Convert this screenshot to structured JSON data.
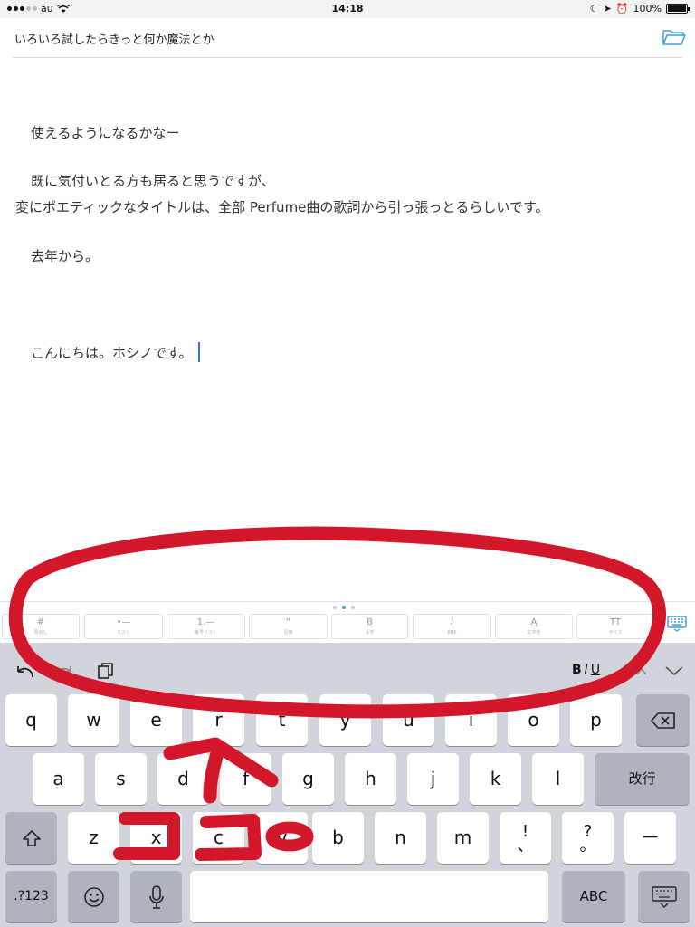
{
  "status": {
    "carrier": "au",
    "time": "14:18",
    "battery": "100%"
  },
  "header": {
    "title": "いろいろ試したらきっと何か魔法とか",
    "folder_icon": "folder-icon"
  },
  "editor": {
    "lines": [
      "使えるようになるかなー",
      "既に気付いとる方も居ると思うですが、",
      "変にポエティックなタイトルは、全部 Perfume曲の歌詞から引っ張っとるらしいです。",
      "去年から。",
      "こんにちは。ホシノです。"
    ],
    "caret_color": "#3b6fe0"
  },
  "toolbar": {
    "page_count": 3,
    "active_page": 1,
    "buttons": [
      {
        "symbol": "#",
        "label": "見出し"
      },
      {
        "symbol": "•—",
        "label": "リスト"
      },
      {
        "symbol": "1.—",
        "label": "番号リスト"
      },
      {
        "symbol": "“",
        "label": "引用"
      },
      {
        "symbol": "B",
        "label": "太字"
      },
      {
        "symbol": "i",
        "label": "斜体"
      },
      {
        "symbol": "A",
        "label": "文字色"
      },
      {
        "symbol": "TT",
        "label": "サイズ"
      }
    ]
  },
  "keyboard": {
    "shortcut": {
      "bold": "B",
      "italic": "I",
      "underline": "U"
    },
    "row1": [
      "q",
      "w",
      "e",
      "r",
      "t",
      "y",
      "u",
      "i",
      "o",
      "p"
    ],
    "row2": [
      "a",
      "s",
      "d",
      "f",
      "g",
      "h",
      "j",
      "k",
      "l"
    ],
    "row3": [
      "z",
      "x",
      "c",
      "v",
      "b",
      "n",
      "m"
    ],
    "return_label": "改行",
    "punct1": [
      "!",
      "、"
    ],
    "punct2": [
      "?",
      "。"
    ],
    "dash": "ー",
    "numbers_label": ".?123",
    "abc_label": "ABC",
    "background": "#d1d5db"
  },
  "annotation": {
    "text": "ココ",
    "color": "#d3172b"
  }
}
